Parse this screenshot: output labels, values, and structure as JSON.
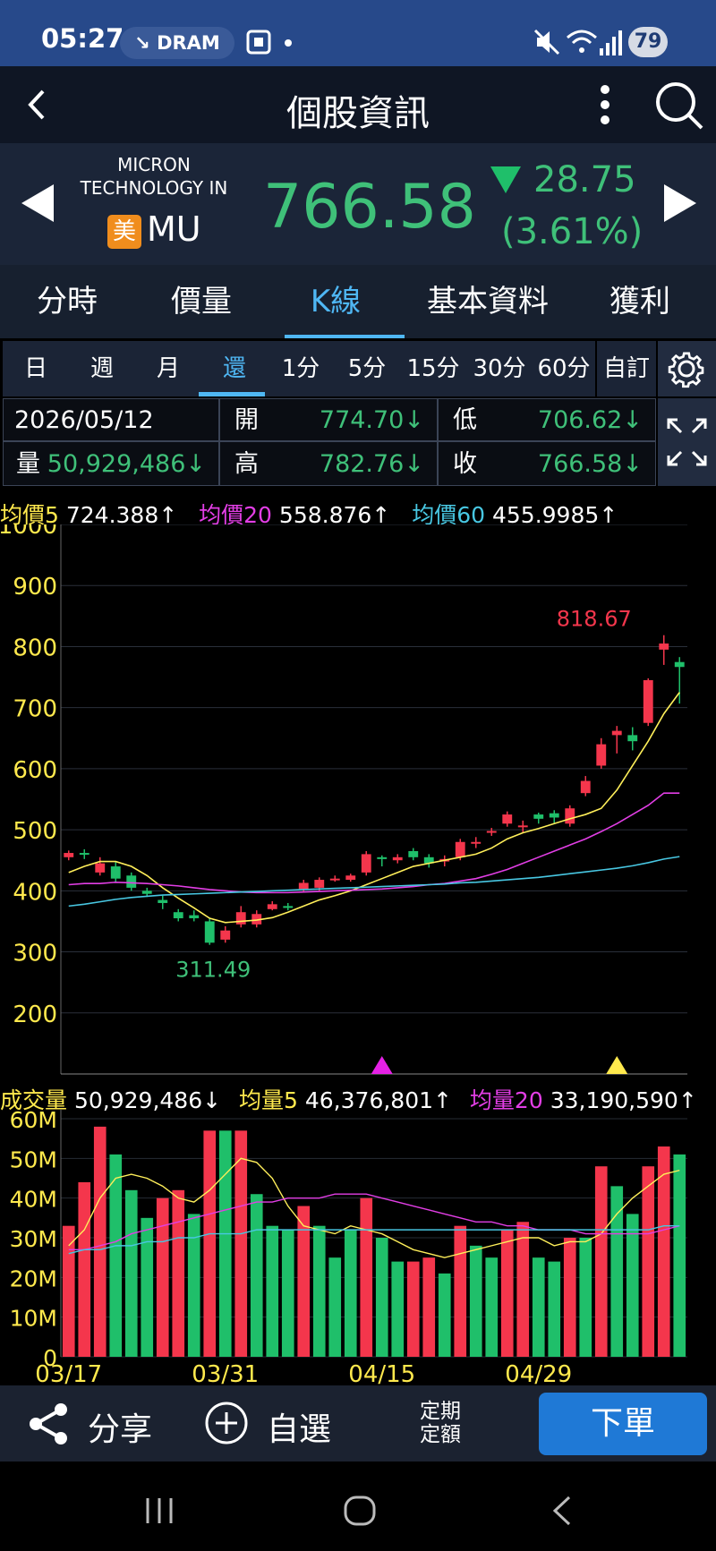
{
  "status_bar": {
    "time": "05:27",
    "ticker_pill": "DRAM",
    "battery": "79"
  },
  "app_bar": {
    "title": "個股資訊"
  },
  "quote": {
    "name_line1": "MICRON",
    "name_line2": "TECHNOLOGY IN",
    "market_badge": "美",
    "symbol": "MU",
    "price": "766.58",
    "change": "28.75",
    "change_pct": "(3.61%)"
  },
  "tabs": [
    "分時",
    "價量",
    "K線",
    "基本資料",
    "獲利"
  ],
  "periods": [
    "日",
    "週",
    "月",
    "還",
    "1分",
    "5分",
    "15分",
    "30分",
    "60分"
  ],
  "custom_label": "自訂",
  "ohlc": {
    "date": "2026/05/12",
    "open_label": "開",
    "open": "774.70↓",
    "low_label": "低",
    "low": "706.62↓",
    "vol_label": "量",
    "vol": "50,929,486↓",
    "high_label": "高",
    "high": "782.76↓",
    "close_label": "收",
    "close": "766.58↓"
  },
  "ma_legend": {
    "ma5_label": "均價5",
    "ma5": "724.388↑",
    "ma20_label": "均價20",
    "ma20": "558.876↑",
    "ma60_label": "均價60",
    "ma60": "455.9985↑"
  },
  "vol_legend": {
    "vol_label": "成交量",
    "vol": "50,929,486↓",
    "mv5_label": "均量5",
    "mv5": "46,376,801↑",
    "mv20_label": "均量20",
    "mv20": "33,190,590↑"
  },
  "bottom_bar": {
    "share": "分享",
    "watch": "自選",
    "regular_1": "定期",
    "regular_2": "定額",
    "order": "下單"
  },
  "colors": {
    "up": "#f4364c",
    "down": "#1fbf6a",
    "ma5": "#ffef5a",
    "ma20": "#e23ee5",
    "ma60": "#48c7e2",
    "axis": "#ffe94d"
  },
  "chart_data": [
    {
      "type": "candlestick",
      "ylim": [
        100,
        1000
      ],
      "yticks": [
        1000,
        900,
        800,
        700,
        600,
        500,
        400,
        300,
        200
      ],
      "x_ticks": [
        "03/17",
        "03/31",
        "04/15",
        "04/29"
      ],
      "x_tick_index": [
        0,
        10,
        20,
        30
      ],
      "annotations": [
        {
          "text": "818.67",
          "index": 38,
          "value": 818.67,
          "kind": "high"
        },
        {
          "text": "311.49",
          "index": 9,
          "value": 311.49,
          "kind": "low"
        }
      ],
      "markers": [
        {
          "index": 20,
          "color": "#e621e6"
        },
        {
          "index": 35,
          "color": "#ffe94d"
        }
      ],
      "candles": [
        {
          "o": 455,
          "c": 462,
          "h": 466,
          "l": 450
        },
        {
          "o": 462,
          "c": 460,
          "h": 468,
          "l": 452
        },
        {
          "o": 430,
          "c": 445,
          "h": 455,
          "l": 425
        },
        {
          "o": 440,
          "c": 420,
          "h": 448,
          "l": 415
        },
        {
          "o": 425,
          "c": 405,
          "h": 430,
          "l": 400
        },
        {
          "o": 400,
          "c": 395,
          "h": 405,
          "l": 390
        },
        {
          "o": 385,
          "c": 380,
          "h": 392,
          "l": 370
        },
        {
          "o": 365,
          "c": 355,
          "h": 370,
          "l": 350
        },
        {
          "o": 360,
          "c": 355,
          "h": 368,
          "l": 350
        },
        {
          "o": 350,
          "c": 315,
          "h": 355,
          "l": 311.49
        },
        {
          "o": 320,
          "c": 335,
          "h": 342,
          "l": 315
        },
        {
          "o": 345,
          "c": 365,
          "h": 375,
          "l": 340
        },
        {
          "o": 345,
          "c": 362,
          "h": 368,
          "l": 340
        },
        {
          "o": 370,
          "c": 378,
          "h": 383,
          "l": 368
        },
        {
          "o": 375,
          "c": 372,
          "h": 380,
          "l": 368
        },
        {
          "o": 403,
          "c": 413,
          "h": 418,
          "l": 398
        },
        {
          "o": 405,
          "c": 418,
          "h": 422,
          "l": 400
        },
        {
          "o": 418,
          "c": 420,
          "h": 425,
          "l": 415
        },
        {
          "o": 418,
          "c": 425,
          "h": 428,
          "l": 415
        },
        {
          "o": 430,
          "c": 460,
          "h": 465,
          "l": 425
        },
        {
          "o": 455,
          "c": 452,
          "h": 458,
          "l": 440
        },
        {
          "o": 450,
          "c": 455,
          "h": 460,
          "l": 445
        },
        {
          "o": 465,
          "c": 455,
          "h": 470,
          "l": 450
        },
        {
          "o": 455,
          "c": 445,
          "h": 460,
          "l": 438
        },
        {
          "o": 448,
          "c": 452,
          "h": 458,
          "l": 440
        },
        {
          "o": 455,
          "c": 480,
          "h": 485,
          "l": 450
        },
        {
          "o": 478,
          "c": 480,
          "h": 488,
          "l": 470
        },
        {
          "o": 495,
          "c": 498,
          "h": 503,
          "l": 490
        },
        {
          "o": 510,
          "c": 525,
          "h": 530,
          "l": 505
        },
        {
          "o": 505,
          "c": 507,
          "h": 515,
          "l": 495
        },
        {
          "o": 525,
          "c": 518,
          "h": 528,
          "l": 510
        },
        {
          "o": 527,
          "c": 520,
          "h": 532,
          "l": 510
        },
        {
          "o": 510,
          "c": 535,
          "h": 540,
          "l": 505
        },
        {
          "o": 560,
          "c": 580,
          "h": 588,
          "l": 555
        },
        {
          "o": 605,
          "c": 640,
          "h": 650,
          "l": 600
        },
        {
          "o": 655,
          "c": 662,
          "h": 670,
          "l": 625
        },
        {
          "o": 655,
          "c": 645,
          "h": 668,
          "l": 630
        },
        {
          "o": 675,
          "c": 745,
          "h": 748,
          "l": 670
        },
        {
          "o": 795,
          "c": 805,
          "h": 818.67,
          "l": 770
        },
        {
          "o": 774.7,
          "c": 766.58,
          "h": 782.76,
          "l": 706.62
        }
      ],
      "ma5": [
        430,
        440,
        448,
        448,
        440,
        425,
        405,
        388,
        372,
        355,
        348,
        350,
        352,
        356,
        365,
        375,
        385,
        392,
        400,
        410,
        420,
        430,
        440,
        445,
        450,
        455,
        460,
        470,
        485,
        495,
        502,
        510,
        518,
        525,
        535,
        565,
        605,
        645,
        690,
        725
      ],
      "ma20": [
        410,
        412,
        412,
        414,
        413,
        412,
        410,
        408,
        405,
        402,
        400,
        398,
        397,
        397,
        397,
        398,
        399,
        400,
        401,
        402,
        403,
        405,
        407,
        410,
        412,
        416,
        420,
        427,
        435,
        445,
        455,
        465,
        475,
        485,
        497,
        510,
        525,
        540,
        560,
        560
      ],
      "ma60": [
        375,
        378,
        382,
        386,
        389,
        391,
        393,
        394,
        395,
        396,
        397,
        398,
        399,
        400,
        401,
        402,
        403,
        404,
        405,
        406,
        407,
        408,
        409,
        410,
        411,
        413,
        414,
        416,
        418,
        420,
        422,
        425,
        428,
        431,
        434,
        437,
        441,
        446,
        452,
        456
      ]
    },
    {
      "type": "bar",
      "ylim": [
        0,
        60
      ],
      "ylabel": "",
      "yticks": [
        "60M",
        "50M",
        "40M",
        "30M",
        "20M",
        "10M",
        "0"
      ],
      "ytick_values": [
        60,
        50,
        40,
        30,
        20,
        10,
        0
      ],
      "values": [
        33,
        44,
        58,
        51,
        42,
        35,
        40,
        42,
        36,
        57,
        57,
        57,
        41,
        33,
        32,
        38,
        33,
        25,
        32,
        40,
        30,
        24,
        24,
        25,
        21,
        33,
        28,
        25,
        32,
        34,
        25,
        24,
        30,
        30,
        48,
        43,
        36,
        48,
        53,
        51
      ],
      "up": [
        1,
        1,
        1,
        0,
        0,
        0,
        1,
        1,
        0,
        1,
        0,
        1,
        0,
        0,
        0,
        1,
        0,
        0,
        0,
        1,
        0,
        0,
        1,
        1,
        0,
        1,
        0,
        0,
        1,
        1,
        0,
        0,
        1,
        0,
        1,
        0,
        0,
        1,
        1,
        0
      ],
      "mv5": [
        28,
        32,
        40,
        45,
        46,
        45,
        43,
        40,
        39,
        42,
        46,
        50,
        49,
        45,
        38,
        33,
        32,
        31,
        33,
        32,
        31,
        29,
        27,
        26,
        25,
        26,
        27,
        28,
        29,
        30,
        30,
        28,
        29,
        29,
        31,
        36,
        40,
        43,
        46,
        47
      ],
      "mv20": [
        27,
        27,
        28,
        29,
        31,
        32,
        33,
        34,
        35,
        36,
        37,
        38,
        39,
        39,
        40,
        40,
        40,
        41,
        41,
        41,
        40,
        39,
        38,
        37,
        36,
        35,
        34,
        34,
        33,
        33,
        32,
        32,
        32,
        31,
        31,
        31,
        31,
        31,
        32,
        33
      ],
      "mv60": [
        26,
        27,
        27,
        28,
        28,
        29,
        29,
        30,
        30,
        31,
        31,
        31,
        32,
        32,
        32,
        32,
        32,
        32,
        32,
        32,
        32,
        32,
        32,
        32,
        32,
        32,
        32,
        32,
        32,
        32,
        32,
        32,
        32,
        32,
        32,
        32,
        32,
        32,
        33,
        33
      ]
    }
  ]
}
